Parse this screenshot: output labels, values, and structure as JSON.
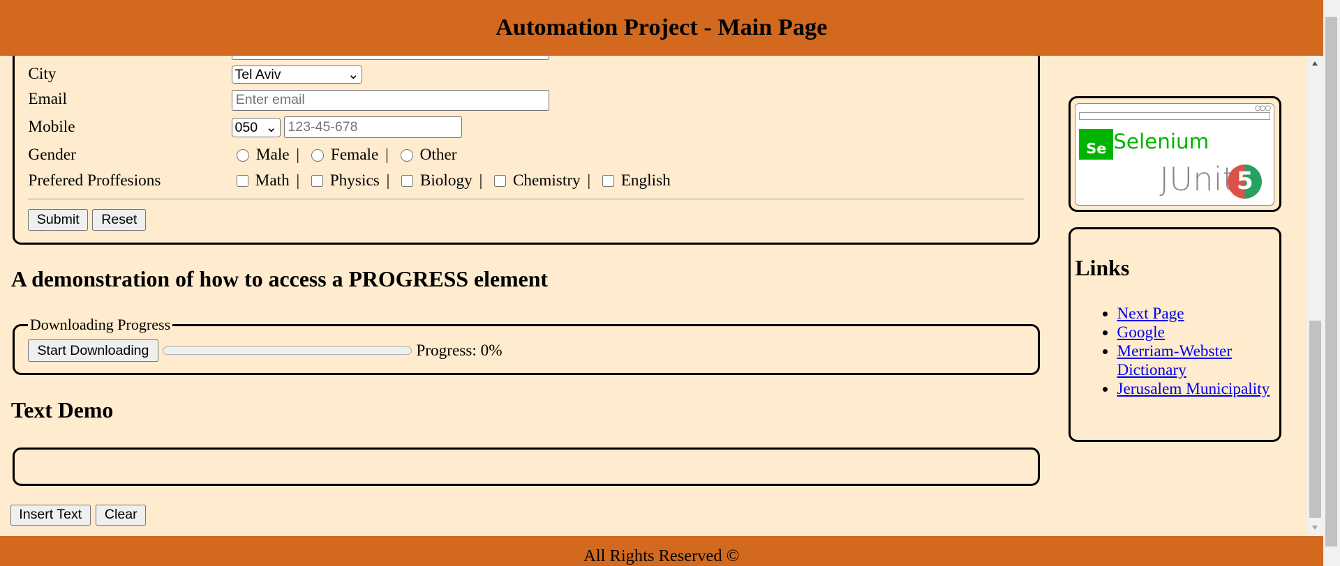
{
  "header": {
    "title": "Automation Project - Main Page"
  },
  "form": {
    "city": {
      "label": "City",
      "value": "Tel Aviv"
    },
    "email": {
      "label": "Email",
      "placeholder": "Enter email",
      "value": ""
    },
    "mobile": {
      "label": "Mobile",
      "prefix": "050",
      "placeholder": "123-45-678"
    },
    "gender": {
      "label": "Gender",
      "options": [
        "Male",
        "Female",
        "Other"
      ]
    },
    "professions": {
      "label": "Prefered Proffesions",
      "options": [
        "Math",
        "Physics",
        "Biology",
        "Chemistry",
        "English"
      ]
    },
    "submit_label": "Submit",
    "reset_label": "Reset"
  },
  "progress_section": {
    "title": "A demonstration of how to access a PROGRESS element",
    "legend": "Downloading Progress",
    "button_label": "Start Downloading",
    "progress_value": 0,
    "progress_text": "Progress: 0%"
  },
  "text_demo": {
    "title": "Text Demo",
    "content": "",
    "insert_label": "Insert Text",
    "clear_label": "Clear"
  },
  "sidebar": {
    "logo": {
      "selenium": "Selenium",
      "se": "Se",
      "junit": "JUnit",
      "five": "5"
    },
    "links_title": "Links",
    "links": [
      "Next Page",
      "Google",
      "Merriam-Webster Dictionary",
      "Jerusalem Municipality"
    ]
  },
  "footer": {
    "text": "All Rights Reserved ©"
  },
  "colors": {
    "header": "#D2691E",
    "background": "#FFEBCD",
    "link": "#0000EE"
  }
}
